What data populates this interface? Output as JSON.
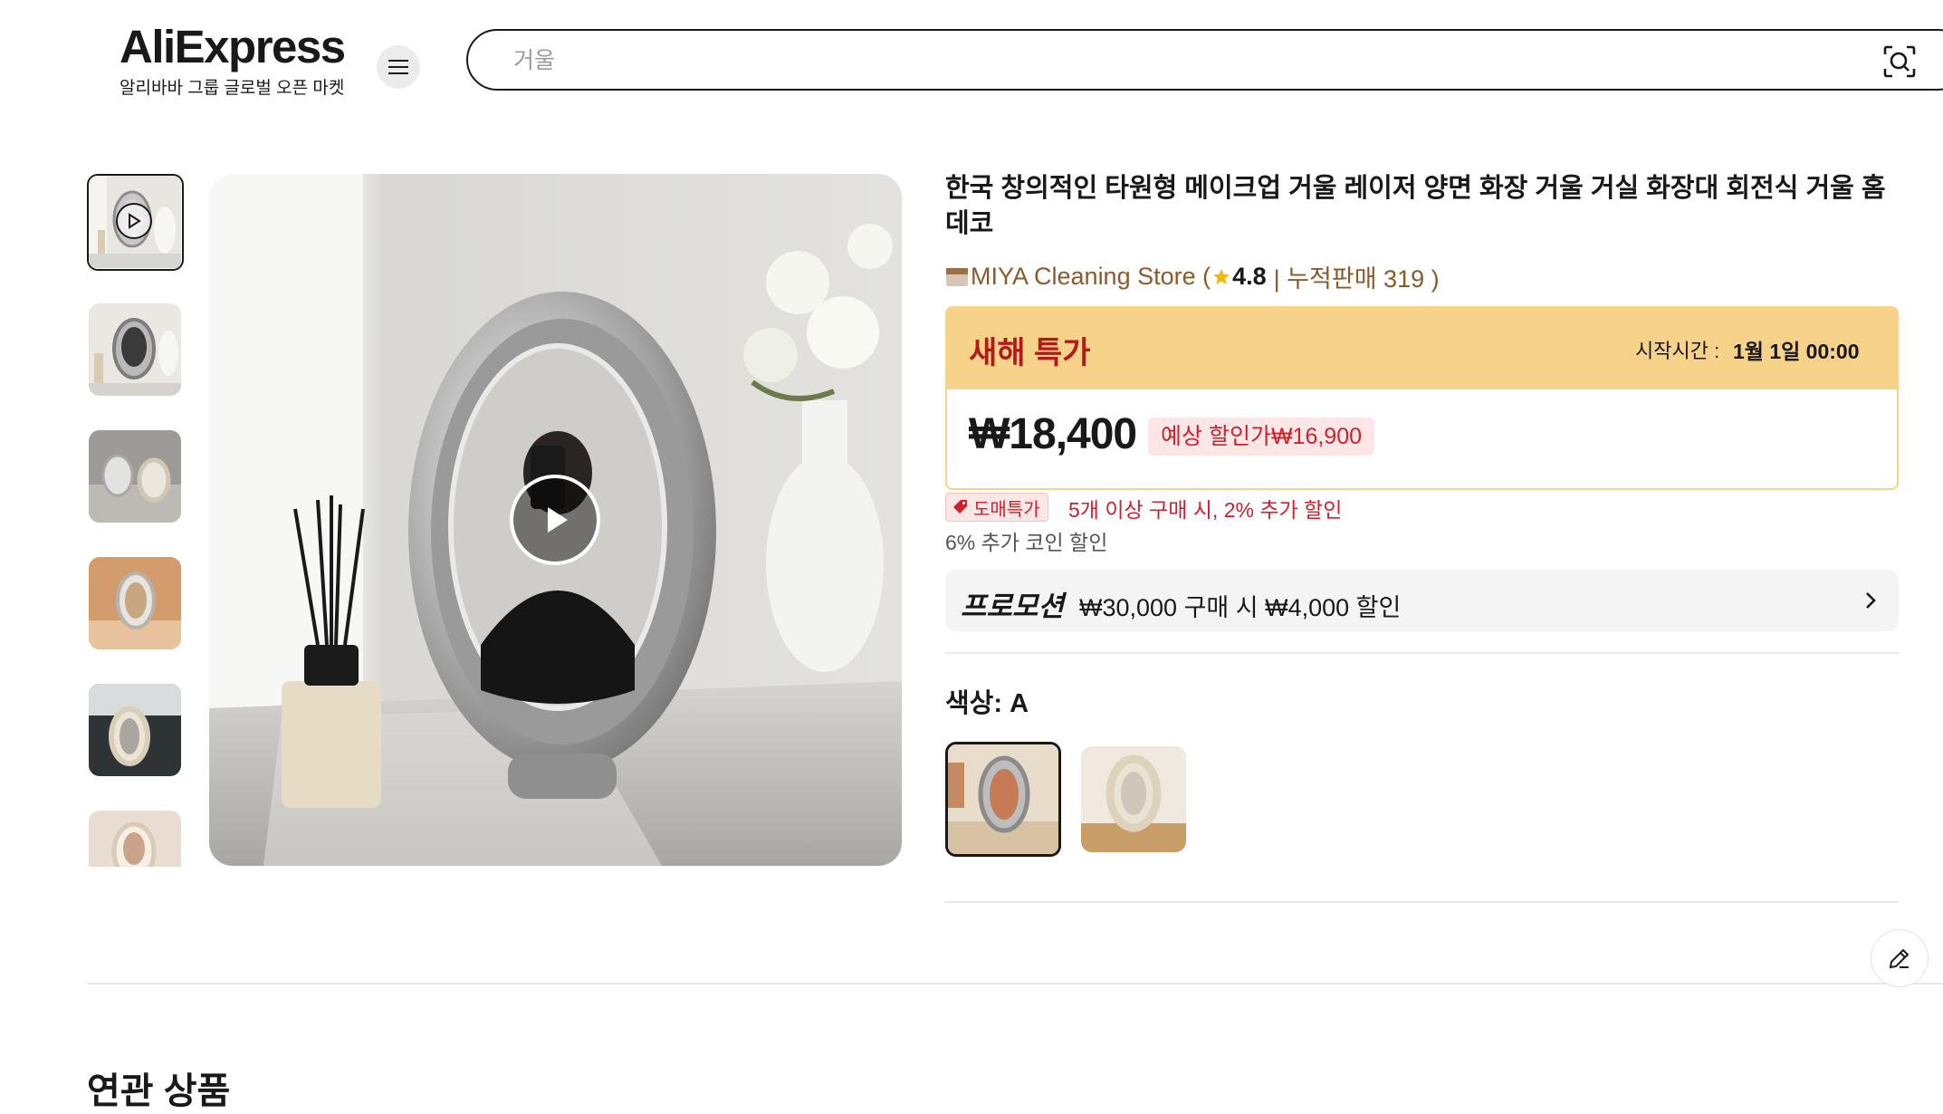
{
  "header": {
    "logo_text": "AliExpress",
    "logo_subtitle": "알리바바 그룹 글로벌 오픈 마켓",
    "menu_icon": "hamburger-menu-icon",
    "search_placeholder": "거울",
    "search_icon": "image-search-icon"
  },
  "gallery": {
    "thumbnail_count": 6,
    "selected_index": 0,
    "video_icon": "play-icon"
  },
  "product": {
    "title": "한국 창의적인 타원형 메이크업 거울 레이저 양면 화장 거울 거실 화장대 회전식 거울 홈 데코",
    "store_name": "MIYA Cleaning Store (",
    "rating": "4.8",
    "sales": "| 누적판매 319 )"
  },
  "deal": {
    "title": "새해 특가",
    "start_label": "시작시간 :",
    "start_time": "1월 1일 00:00",
    "price": "₩18,400",
    "estimated_price": "예상 할인가₩16,900"
  },
  "wholesale": {
    "tag": "도매특가",
    "text": "5개 이상 구매 시, 2% 추가 할인"
  },
  "coin_text": "6% 추가 코인 할인",
  "promotion": {
    "label": "프로모션",
    "text": "₩30,000 구매 시 ₩4,000 할인"
  },
  "color_option": {
    "label": "색상: A",
    "selected_index": 0
  },
  "related": {
    "heading": "연관 상품"
  },
  "colors": {
    "deal_yellow": "#f7d28a",
    "deal_red": "#b31b1b",
    "price_red": "#d0202e",
    "store_brown": "#8b5a2b"
  }
}
